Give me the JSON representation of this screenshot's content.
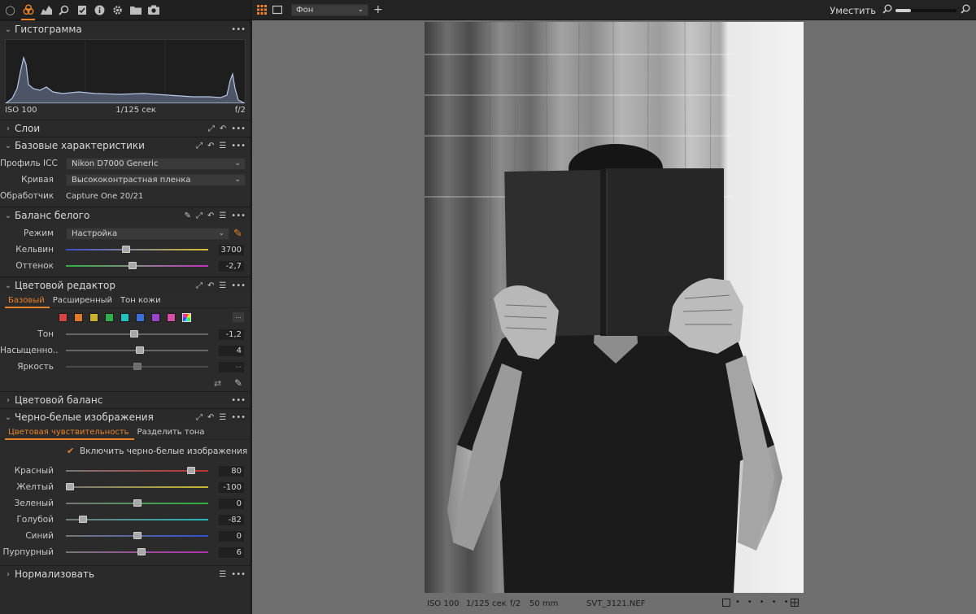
{
  "left_panel": {
    "top_tools": [
      "camera-circle-icon",
      "color-balance-icon",
      "exposure-icon",
      "details-search-icon",
      "metadata-check-icon",
      "info-icon",
      "settings-gear-icon",
      "folder-icon",
      "capture-camera-icon"
    ],
    "histogram": {
      "title": "Гистограмма",
      "iso": "ISO 100",
      "shutter": "1/125 сек",
      "aperture": "f/2"
    },
    "layers": {
      "title": "Слои"
    },
    "basic": {
      "title": "Базовые характеристики",
      "rows": [
        {
          "label": "Профиль ICC",
          "value": "Nikon D7000 Generic"
        },
        {
          "label": "Кривая",
          "value": "Высококонтрастная пленка"
        },
        {
          "label": "Обработчик",
          "value": "Capture One 20/21"
        }
      ]
    },
    "white_balance": {
      "title": "Баланс белого",
      "mode_label": "Режим",
      "mode_value": "Настройка",
      "kelvin_label": "Кельвин",
      "kelvin_value": "3700",
      "kelvin_pos": 0.42,
      "tint_label": "Оттенок",
      "tint_value": "-2,7",
      "tint_pos": 0.47
    },
    "color_editor": {
      "title": "Цветовой редактор",
      "tabs": [
        "Базовый",
        "Расширенный",
        "Тон кожи"
      ],
      "swatch_colors": [
        "#d64545",
        "#e07a2a",
        "#c9b22c",
        "#2fb04b",
        "#1fc1c1",
        "#3a6fd8",
        "#9a45c9",
        "#d64fa3"
      ],
      "more_label": "...",
      "sliders": [
        {
          "label": "Тон",
          "value": "-1,2",
          "pos": 0.48,
          "dim": false
        },
        {
          "label": "Насыщенно...",
          "value": "4",
          "pos": 0.52,
          "dim": false
        },
        {
          "label": "Яркость",
          "value": "--",
          "pos": 0.5,
          "dim": true
        }
      ]
    },
    "color_balance": {
      "title": "Цветовой баланс"
    },
    "bw": {
      "title": "Черно-белые изображения",
      "tabs": [
        "Цветовая чувствительность",
        "Разделить тона"
      ],
      "enable_label": "Включить черно-белые изображения",
      "sliders": [
        {
          "label": "Красный",
          "value": "80",
          "pos": 0.88,
          "color": "#c03030"
        },
        {
          "label": "Желтый",
          "value": "-100",
          "pos": 0.03,
          "color": "#c8b830"
        },
        {
          "label": "Зеленый",
          "value": "0",
          "pos": 0.5,
          "color": "#30b040"
        },
        {
          "label": "Голубой",
          "value": "-82",
          "pos": 0.12,
          "color": "#20b8b8"
        },
        {
          "label": "Синий",
          "value": "0",
          "pos": 0.5,
          "color": "#3050d0"
        },
        {
          "label": "Пурпурный",
          "value": "6",
          "pos": 0.53,
          "color": "#b030b0"
        }
      ]
    },
    "normalize": {
      "title": "Нормализовать"
    }
  },
  "viewer": {
    "background_select": "Фон",
    "fit_label": "Уместить",
    "zoom_level": 0.25,
    "status": {
      "iso": "ISO 100",
      "shutter": "1/125 сек",
      "aperture": "f/2",
      "focal": "50 mm",
      "filename": "SVT_3121.NEF"
    }
  }
}
